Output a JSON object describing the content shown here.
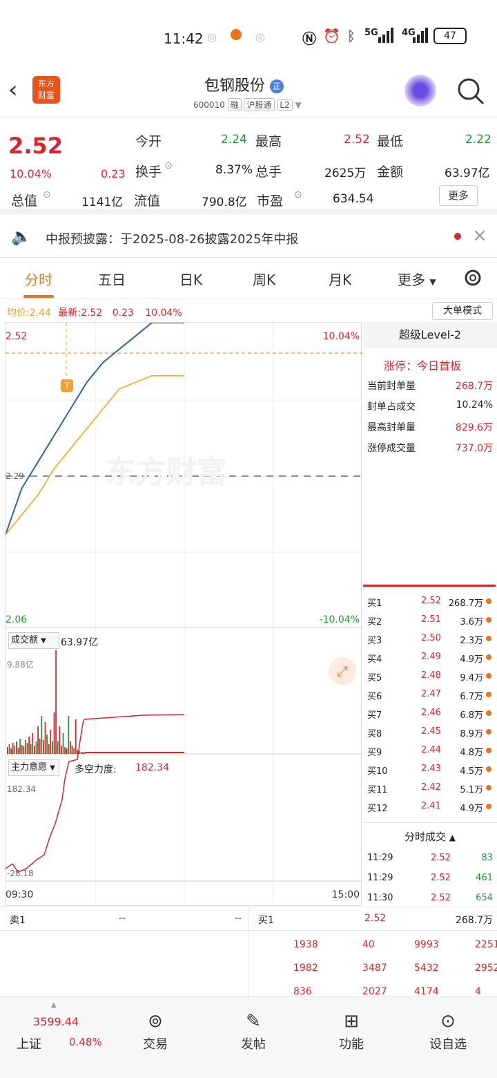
{
  "status_bar": {
    "time": "11:42",
    "battery": "47",
    "net1": "5G",
    "net2": "4G"
  },
  "header": {
    "logo_line1": "东方",
    "logo_line2": "财富",
    "title": "包钢股份",
    "title_badge": "正",
    "code": "600010",
    "tag1": "融",
    "tag2": "沪股通",
    "tag3": "L2"
  },
  "quote": {
    "price": "2.52",
    "change_pct": "10.04%",
    "change": "0.23",
    "open_label": "今开",
    "open": "2.24",
    "high_label": "最高",
    "high": "2.52",
    "low_label": "最低",
    "low": "2.22",
    "turnover_label": "换手",
    "turnover": "8.37%",
    "vol_label": "总手",
    "vol": "2625万",
    "amount_label": "金额",
    "amount": "63.97亿",
    "mcap_label": "总值",
    "mcap": "1141亿",
    "float_label": "流值",
    "float": "790.8亿",
    "pe_label": "市盈",
    "pe": "634.54",
    "more_btn": "更多"
  },
  "notice": {
    "text": "中报预披露：于2025-08-26披露2025年中报"
  },
  "tabs": {
    "t1": "分时",
    "t2": "五日",
    "t3": "日K",
    "t4": "周K",
    "t5": "月K",
    "t6": "更多"
  },
  "chart_info": {
    "avg_label": "均价",
    "avg": "2.44",
    "latest_label": "最新",
    "latest": "2.52",
    "latest_chg": "0.23",
    "latest_pct": "10.04%",
    "mode_btn": "大单模式",
    "y_top": "2.52",
    "y_top_pct": "10.04%",
    "y_mid": "2.29",
    "y_bot": "2.06",
    "y_bot_pct": "-10.04%",
    "watermark": "东方财富",
    "t_marker": "T",
    "vol_selector": "成交额",
    "vol_value": "63.97亿",
    "vol_max": "9.88亿",
    "ind_selector": "主力意愿",
    "ind_label": "多空力度:",
    "ind_value": "182.34",
    "ind_top": "182.34",
    "ind_bot": "-28.18",
    "time_start": "09:30",
    "time_end": "15:00"
  },
  "chart_data": {
    "type": "line",
    "ylim": [
      2.06,
      2.52
    ],
    "series": [
      {
        "values": [
          2.2,
          2.27,
          2.31,
          2.35,
          2.39,
          2.43,
          2.46,
          2.48,
          2.5,
          2.52,
          2.52,
          2.52
        ]
      },
      {
        "values": [
          2.2,
          2.23,
          2.26,
          2.3,
          2.33,
          2.36,
          2.39,
          2.42,
          2.43,
          2.44,
          2.44,
          2.44
        ]
      }
    ]
  },
  "side": {
    "title": "超级Level-2",
    "zt_label": "涨停：今日首板",
    "rows": [
      {
        "label": "当前封单量",
        "value": "268.7万"
      },
      {
        "label": "封单占成交",
        "value": "10.24%"
      },
      {
        "label": "最高封单量",
        "value": "829.6万"
      },
      {
        "label": "涨停成交量",
        "value": "737.0万"
      }
    ],
    "orderbook": [
      {
        "label": "买1",
        "price": "2.52",
        "vol": "268.7万"
      },
      {
        "label": "买2",
        "price": "2.51",
        "vol": "3.6万"
      },
      {
        "label": "买3",
        "price": "2.50",
        "vol": "2.3万"
      },
      {
        "label": "买4",
        "price": "2.49",
        "vol": "4.9万"
      },
      {
        "label": "买5",
        "price": "2.48",
        "vol": "9.4万"
      },
      {
        "label": "买6",
        "price": "2.47",
        "vol": "6.7万"
      },
      {
        "label": "买7",
        "price": "2.46",
        "vol": "6.8万"
      },
      {
        "label": "买8",
        "price": "2.45",
        "vol": "8.9万"
      },
      {
        "label": "买9",
        "price": "2.44",
        "vol": "4.8万"
      },
      {
        "label": "买10",
        "price": "2.43",
        "vol": "4.5万"
      },
      {
        "label": "买11",
        "price": "2.42",
        "vol": "5.1万"
      },
      {
        "label": "买12",
        "price": "2.41",
        "vol": "4.9万"
      }
    ],
    "ticks_title": "分时成交",
    "ticks": [
      {
        "time": "11:29",
        "price": "2.52",
        "vol": "83"
      },
      {
        "time": "11:29",
        "price": "2.52",
        "vol": "461"
      },
      {
        "time": "11:30",
        "price": "2.52",
        "vol": "654"
      }
    ]
  },
  "book": {
    "sell1_label": "卖1",
    "sell1_a": "--",
    "sell1_b": "--",
    "buy1_label": "买1",
    "buy1_price": "2.52",
    "buy1_vol": "268.7万",
    "queue": [
      [
        "1938",
        "40",
        "9993",
        "2251"
      ],
      [
        "1982",
        "3487",
        "5432",
        "2952"
      ],
      [
        "836",
        "2027",
        "4174",
        "4"
      ]
    ]
  },
  "nav": {
    "index_value": "3599.44",
    "index_name": "上证",
    "index_pct": "0.48%",
    "trade": "交易",
    "post": "发帖",
    "func": "功能",
    "watch": "设自选"
  }
}
